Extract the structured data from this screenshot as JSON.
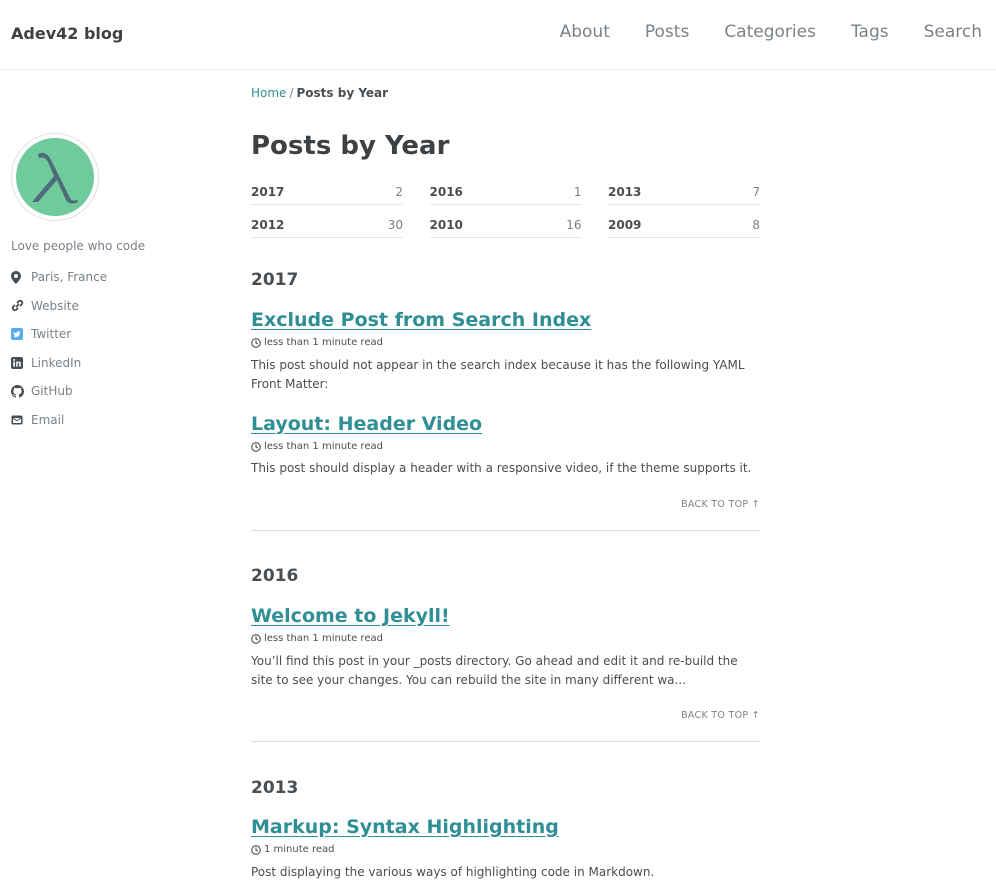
{
  "header": {
    "site_title": "Adev42 blog",
    "nav": [
      {
        "label": "About"
      },
      {
        "label": "Posts"
      },
      {
        "label": "Categories"
      },
      {
        "label": "Tags"
      },
      {
        "label": "Search"
      }
    ]
  },
  "breadcrumb": {
    "home": "Home",
    "separator": "/",
    "current": "Posts by Year"
  },
  "author": {
    "bio": "Love people who code",
    "links": [
      {
        "label": "Paris, France",
        "icon": "map-marker-icon"
      },
      {
        "label": "Website",
        "icon": "link-icon"
      },
      {
        "label": "Twitter",
        "icon": "twitter-icon"
      },
      {
        "label": "LinkedIn",
        "icon": "linkedin-icon"
      },
      {
        "label": "GitHub",
        "icon": "github-icon"
      },
      {
        "label": "Email",
        "icon": "envelope-icon"
      }
    ]
  },
  "main": {
    "title": "Posts by Year",
    "year_counts": [
      {
        "year": "2017",
        "count": "2"
      },
      {
        "year": "2016",
        "count": "1"
      },
      {
        "year": "2013",
        "count": "7"
      },
      {
        "year": "2012",
        "count": "30"
      },
      {
        "year": "2010",
        "count": "16"
      },
      {
        "year": "2009",
        "count": "8"
      }
    ],
    "back_to_top": "Back to Top ↑",
    "sections": [
      {
        "year": "2017",
        "posts": [
          {
            "title": "Exclude Post from Search Index",
            "read_time": "less than 1 minute read",
            "excerpt": "This post should not appear in the search index because it has the following YAML Front Matter:"
          },
          {
            "title": "Layout: Header Video",
            "read_time": "less than 1 minute read",
            "excerpt": "This post should display a header with a responsive video, if the theme supports it."
          }
        ]
      },
      {
        "year": "2016",
        "posts": [
          {
            "title": "Welcome to Jekyll!",
            "read_time": "less than 1 minute read",
            "excerpt": "You’ll find this post in your _posts directory. Go ahead and edit it and re-build the site to see your changes. You can rebuild the site in many different wa..."
          }
        ]
      },
      {
        "year": "2013",
        "posts": [
          {
            "title": "Markup: Syntax Highlighting",
            "read_time": "1 minute read",
            "excerpt": "Post displaying the various ways of highlighting code in Markdown."
          }
        ]
      }
    ]
  },
  "colors": {
    "link": "#2f8f95",
    "avatar_bg": "#6fcb9b",
    "text": "#494e52",
    "muted": "#7a8288"
  }
}
